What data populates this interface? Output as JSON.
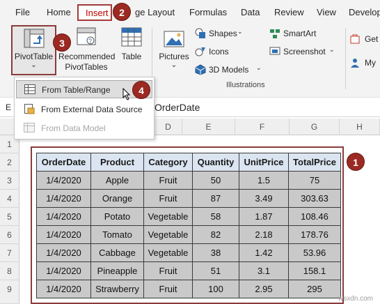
{
  "menu": {
    "tabs": [
      "File",
      "Home",
      "Insert",
      "ge Layout",
      "Formulas",
      "Data",
      "Review",
      "View",
      "Develop"
    ]
  },
  "callouts": [
    "1",
    "2",
    "3",
    "4"
  ],
  "ribbon": {
    "pivot_table": "PivotTable",
    "recommended_1": "Recommended",
    "recommended_2": "PivotTables",
    "table": "Table",
    "pictures": "Pictures",
    "shapes": "Shapes",
    "icons": "Icons",
    "models_3d": "3D Models",
    "smartart": "SmartArt",
    "screenshot": "Screenshot",
    "illustrations_group": "Illustrations",
    "get": "Get",
    "my": "My"
  },
  "dropdown": {
    "items": [
      "From Table/Range",
      "From External Data Source",
      "From Data Model"
    ]
  },
  "formula_bar": {
    "name_box_partial": "E",
    "content": "OrderDate"
  },
  "grid": {
    "column_headers": [
      "D",
      "E",
      "F",
      "G",
      "H"
    ],
    "row_headers": [
      "1",
      "2",
      "3",
      "4",
      "5",
      "6",
      "7",
      "8",
      "9"
    ]
  },
  "table": {
    "headers": [
      "OrderDate",
      "Product",
      "Category",
      "Quantity",
      "UnitPrice",
      "TotalPrice"
    ],
    "rows": [
      [
        "1/4/2020",
        "Apple",
        "Fruit",
        "50",
        "1.5",
        "75"
      ],
      [
        "1/4/2020",
        "Orange",
        "Fruit",
        "87",
        "3.49",
        "303.63"
      ],
      [
        "1/4/2020",
        "Potato",
        "Vegetable",
        "58",
        "1.87",
        "108.46"
      ],
      [
        "1/4/2020",
        "Tomato",
        "Vegetable",
        "82",
        "2.18",
        "178.76"
      ],
      [
        "1/4/2020",
        "Cabbage",
        "Vegetable",
        "38",
        "1.42",
        "53.96"
      ],
      [
        "1/4/2020",
        "Pineapple",
        "Fruit",
        "51",
        "3.1",
        "158.1"
      ],
      [
        "1/4/2020",
        "Strawberry",
        "Fruit",
        "100",
        "2.95",
        "295"
      ]
    ]
  },
  "watermark": "wsxdn.com",
  "colors": {
    "accent": "#9b2a22",
    "header_fill": "#dbe5f1",
    "cell_fill": "#c9c9c9"
  }
}
